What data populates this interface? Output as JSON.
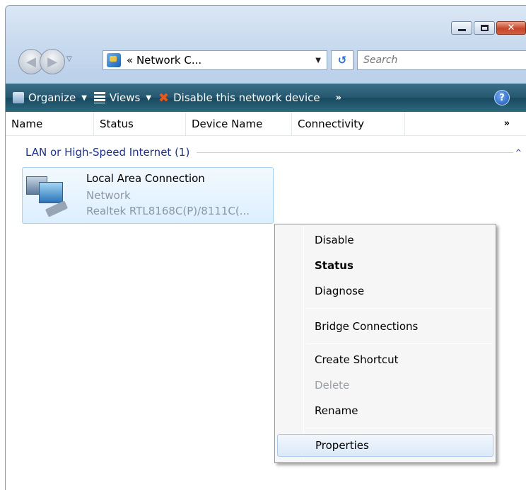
{
  "address_bar": {
    "breadcrumb": "« Network C...",
    "search_placeholder": "Search"
  },
  "caption_buttons": {
    "close_glyph": "✕"
  },
  "toolbar": {
    "organize_label": "Organize",
    "views_label": "Views",
    "disable_label": "Disable this network device",
    "more_label": "»",
    "help_label": "?"
  },
  "columns": {
    "name": "Name",
    "status": "Status",
    "device_name": "Device Name",
    "connectivity": "Connectivity",
    "more": "»"
  },
  "group": {
    "title": "LAN or High-Speed Internet (1)",
    "collapse_glyph": "^"
  },
  "item": {
    "name": "Local Area Connection",
    "status": "Network",
    "device": "Realtek RTL8168C(P)/8111C(..."
  },
  "context_menu": {
    "items": [
      {
        "label": "Disable"
      },
      {
        "label": "Status"
      },
      {
        "label": "Diagnose"
      },
      {
        "label": "Bridge Connections"
      },
      {
        "label": "Create Shortcut"
      },
      {
        "label": "Delete"
      },
      {
        "label": "Rename"
      },
      {
        "label": "Properties"
      }
    ]
  },
  "colors": {
    "toolbar": "#25586f",
    "group_title": "#1e3287",
    "selection": "#dcefff"
  }
}
